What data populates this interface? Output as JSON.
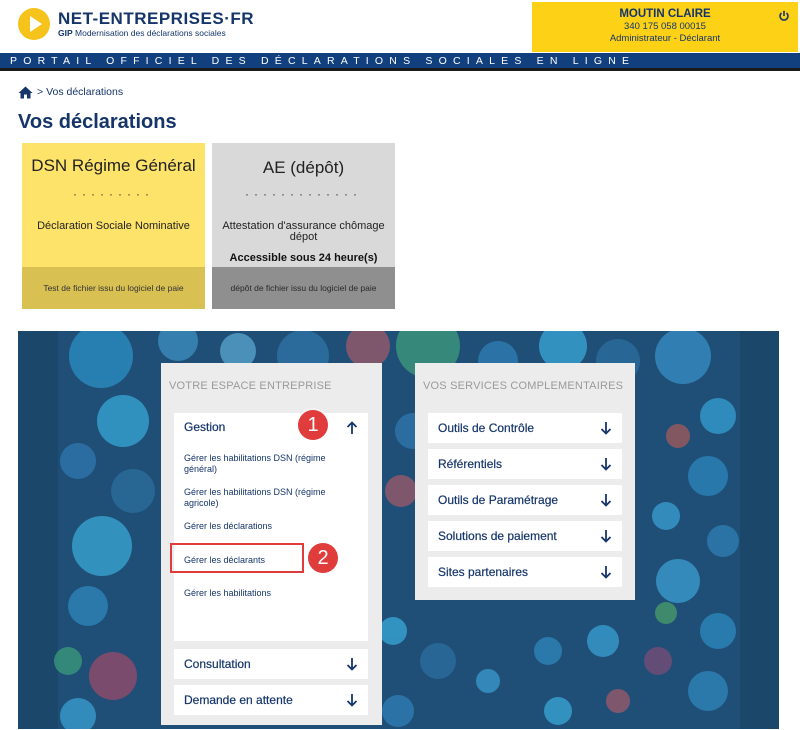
{
  "brand": {
    "name": "NET-ENTREPRISES·FR",
    "sub_bold": "GIP",
    "sub_rest": " Modernisation des déclarations sociales"
  },
  "user": {
    "name": "MOUTIN CLAIRE",
    "siret": "340 175 058 00015",
    "role": "Administrateur - Déclarant"
  },
  "banner": "PORTAIL OFFICIEL DES DÉCLARATIONS SOCIALES EN LIGNE",
  "breadcrumb": {
    "separator": ">",
    "current": "Vos déclarations"
  },
  "page_title": "Vos déclarations",
  "tiles": [
    {
      "title": "DSN Régime Général",
      "dots": "·········",
      "description": "Déclaration Sociale Nominative",
      "footer": "Test de fichier issu du logiciel de paie"
    },
    {
      "title": "AE (dépôt)",
      "dots": "·············",
      "description": "Attestation d'assurance chômage dépot",
      "access": "Accessible sous 24 heure(s)",
      "footer": "dépôt de fichier issu du logiciel de paie"
    }
  ],
  "espace": {
    "title": "VOTRE ESPACE ENTREPRISE",
    "sections": [
      {
        "label": "Gestion",
        "expanded": true
      },
      {
        "label": "Consultation",
        "expanded": false
      },
      {
        "label": "Demande en attente",
        "expanded": false
      }
    ],
    "gestion_items": [
      "Gérer les habilitations DSN (régime général)",
      "Gérer les habilitations DSN (régime agricole)",
      "Gérer les déclarations",
      "Gérer les déclarants",
      "Gérer les habilitations"
    ]
  },
  "services": {
    "title": "VOS SERVICES COMPLEMENTAIRES",
    "items": [
      "Outils de Contrôle",
      "Référentiels",
      "Outils de Paramétrage",
      "Solutions de paiement",
      "Sites partenaires"
    ]
  },
  "annotations": [
    "1",
    "2"
  ],
  "colors": {
    "navy": "#15356a",
    "yellow": "#fcd116",
    "tile_yellow": "#fde36a",
    "tile_grey": "#d9d9d9",
    "panel": "#1f4f77",
    "annotation_red": "#e03c3c"
  }
}
